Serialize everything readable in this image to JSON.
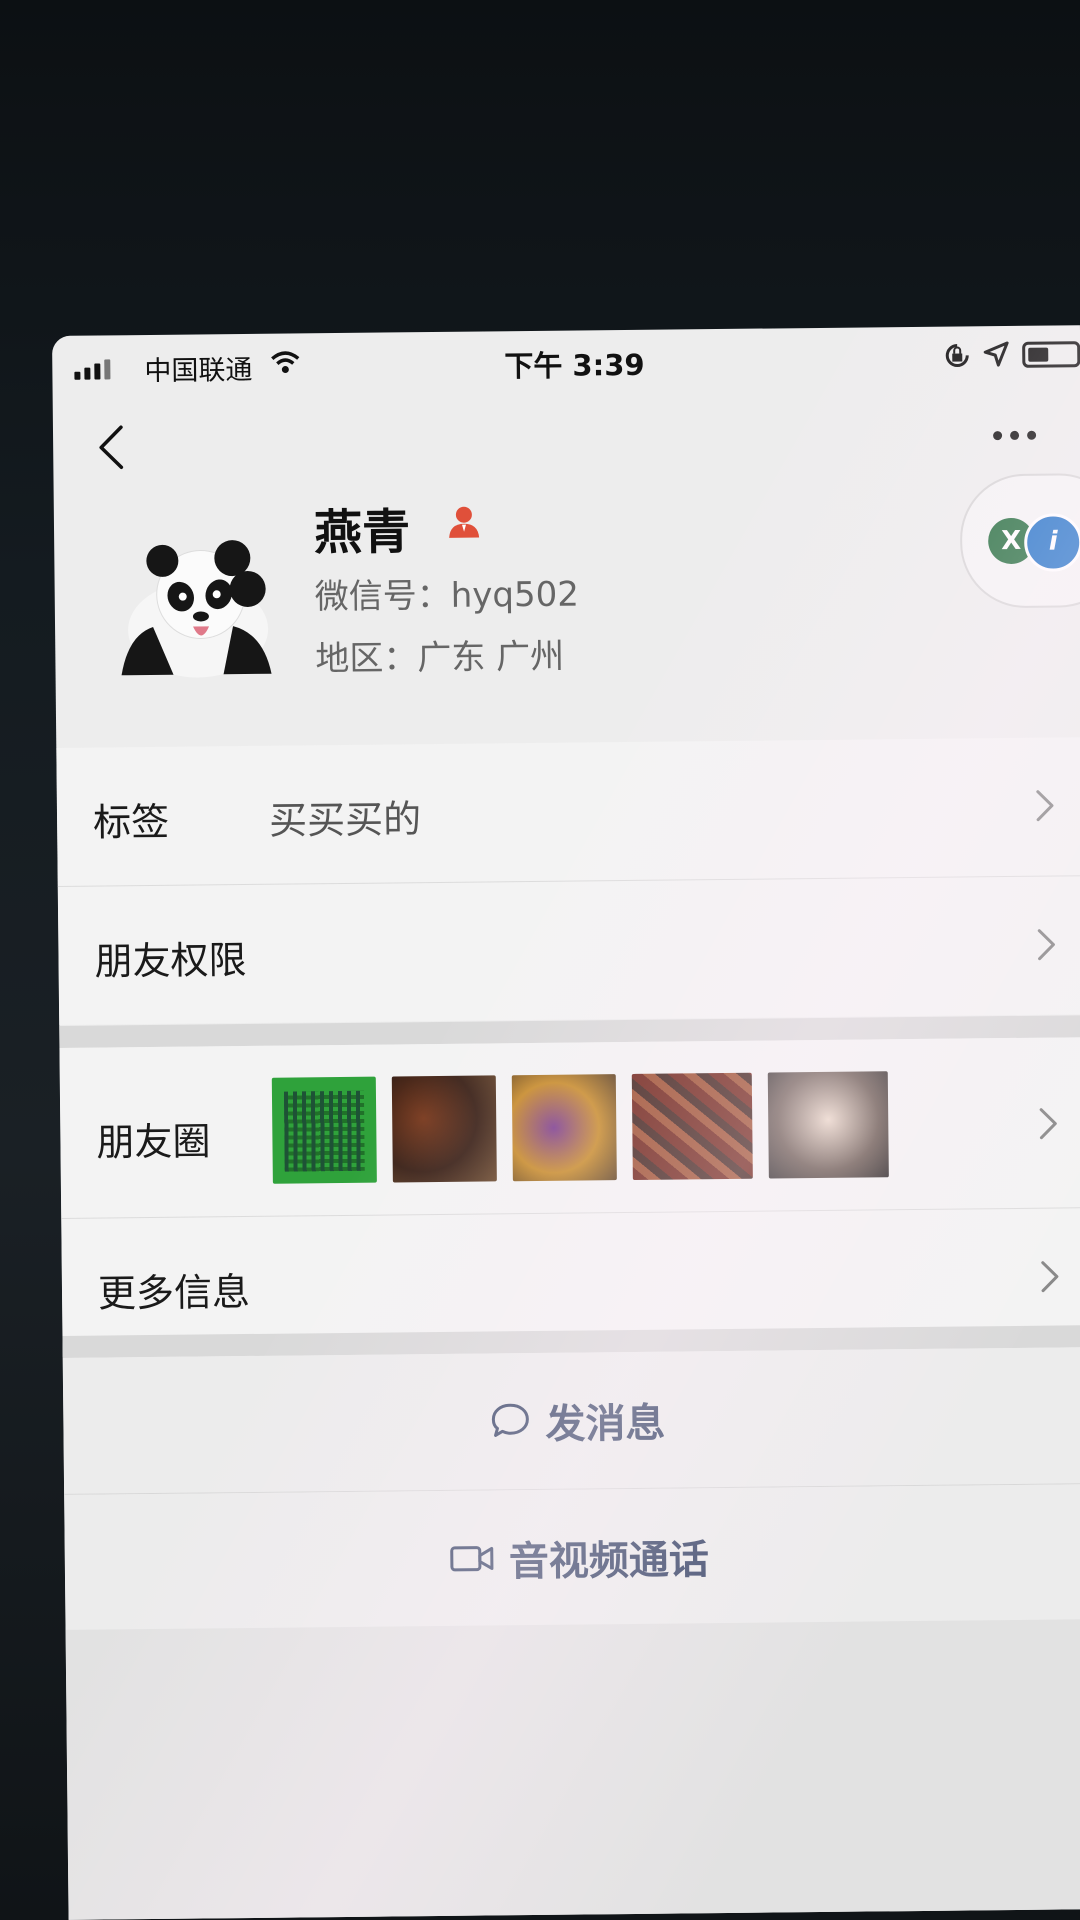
{
  "status_bar": {
    "carrier": "中国联通",
    "time": "下午 3:39"
  },
  "profile": {
    "name": "燕青",
    "wechat_id": "微信号：hyq502",
    "region": "地区：广东 广州",
    "quick_apps": [
      "X",
      "i"
    ]
  },
  "info_rows": [
    {
      "label": "标签",
      "value": "买买买的"
    },
    {
      "label": "朋友权限",
      "value": ""
    }
  ],
  "more_rows": {
    "moments_label": "朋友圈",
    "more_info_label": "更多信息"
  },
  "actions": {
    "message": "发消息",
    "av_call": "音视频通话"
  },
  "colors": {
    "action_text": "#3d4a6b",
    "qr_thumb": "#2fa23b",
    "person_icon": "#e0503a"
  }
}
